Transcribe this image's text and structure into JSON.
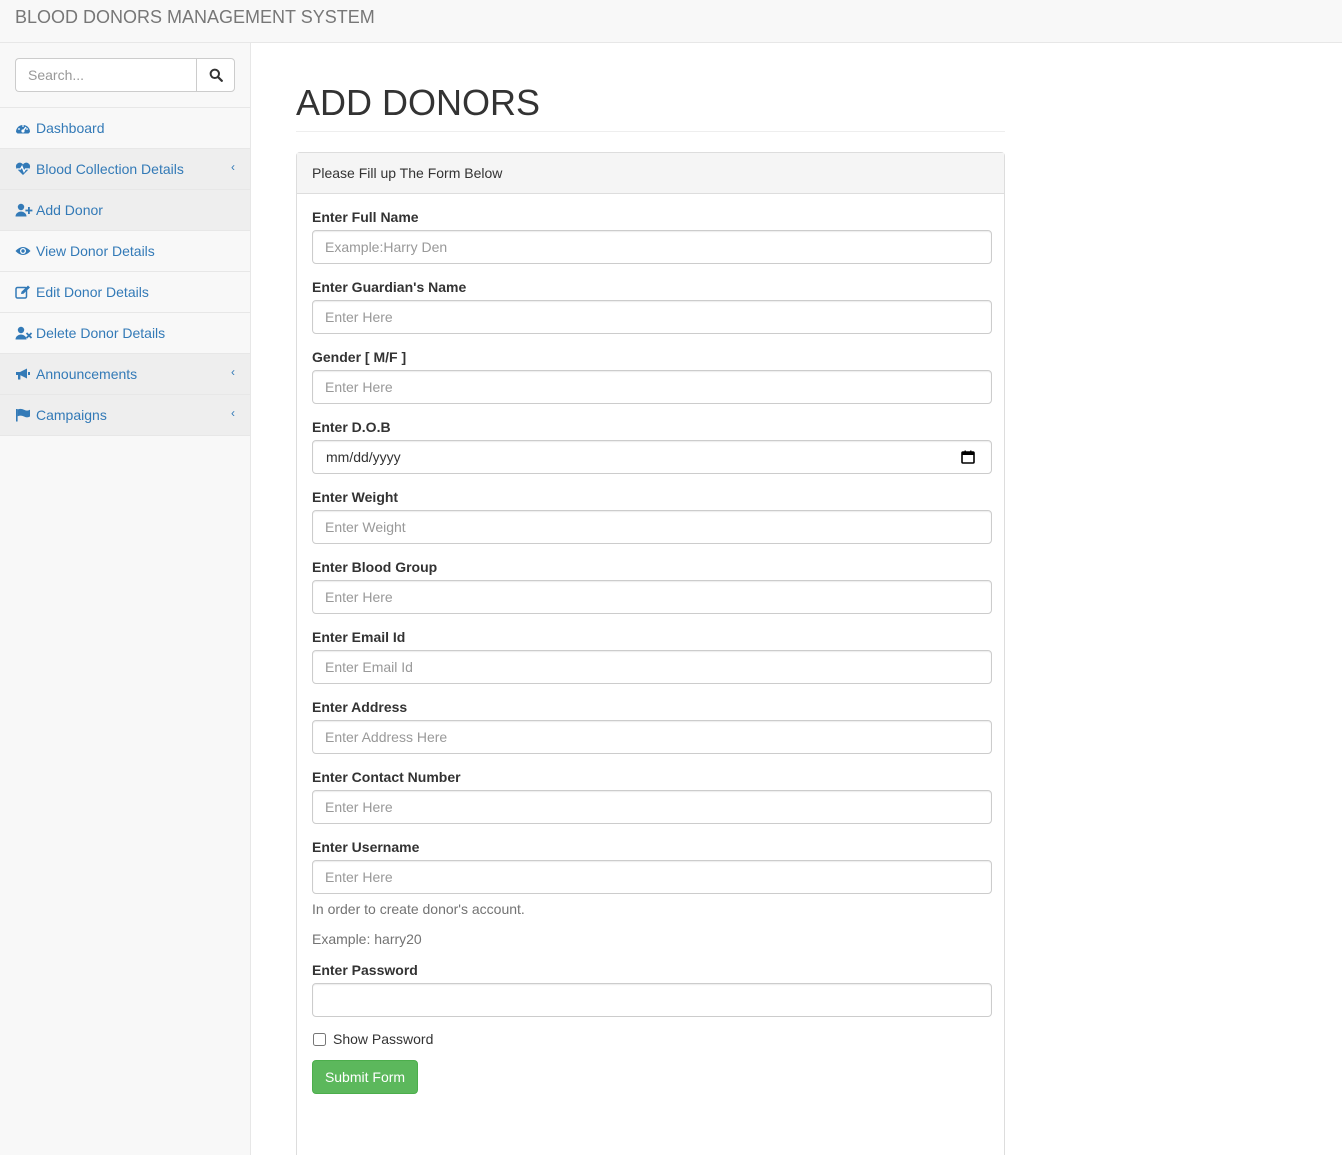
{
  "app": {
    "title": "BLOOD DONORS MANAGEMENT SYSTEM"
  },
  "sidebar": {
    "search_placeholder": "Search...",
    "items": [
      {
        "label": "Dashboard",
        "icon": "dashboard-icon",
        "has_arrow": false
      },
      {
        "label": "Blood Collection Details",
        "icon": "heartbeat-icon",
        "has_arrow": true
      },
      {
        "label": "Add Donor",
        "icon": "user-plus-icon",
        "has_arrow": false
      },
      {
        "label": "View Donor Details",
        "icon": "eye-icon",
        "has_arrow": false
      },
      {
        "label": "Edit Donor Details",
        "icon": "edit-icon",
        "has_arrow": false
      },
      {
        "label": "Delete Donor Details",
        "icon": "user-times-icon",
        "has_arrow": false
      },
      {
        "label": "Announcements",
        "icon": "bullhorn-icon",
        "has_arrow": true
      },
      {
        "label": "Campaigns",
        "icon": "flag-icon",
        "has_arrow": true
      }
    ]
  },
  "main": {
    "title": "ADD DONORS",
    "panel_heading": "Please Fill up The Form Below",
    "fields": {
      "full_name": {
        "label": "Enter Full Name",
        "placeholder": "Example:Harry Den"
      },
      "guardian": {
        "label": "Enter Guardian's Name",
        "placeholder": "Enter Here"
      },
      "gender": {
        "label": "Gender [ M/F ]",
        "placeholder": "Enter Here"
      },
      "dob": {
        "label": "Enter D.O.B",
        "value": "mm/dd/yyyy"
      },
      "weight": {
        "label": "Enter Weight",
        "placeholder": "Enter Weight"
      },
      "blood_group": {
        "label": "Enter Blood Group",
        "placeholder": "Enter Here"
      },
      "email": {
        "label": "Enter Email Id",
        "placeholder": "Enter Email Id"
      },
      "address": {
        "label": "Enter Address",
        "placeholder": "Enter Address Here"
      },
      "contact": {
        "label": "Enter Contact Number",
        "placeholder": "Enter Here"
      },
      "username": {
        "label": "Enter Username",
        "placeholder": "Enter Here",
        "help1": "In order to create donor's account.",
        "help2": "Example: harry20"
      },
      "password": {
        "label": "Enter Password",
        "placeholder": ""
      }
    },
    "show_password_label": "Show Password",
    "submit_label": "Submit Form"
  },
  "colors": {
    "link": "#337ab7",
    "success": "#5cb85c"
  }
}
